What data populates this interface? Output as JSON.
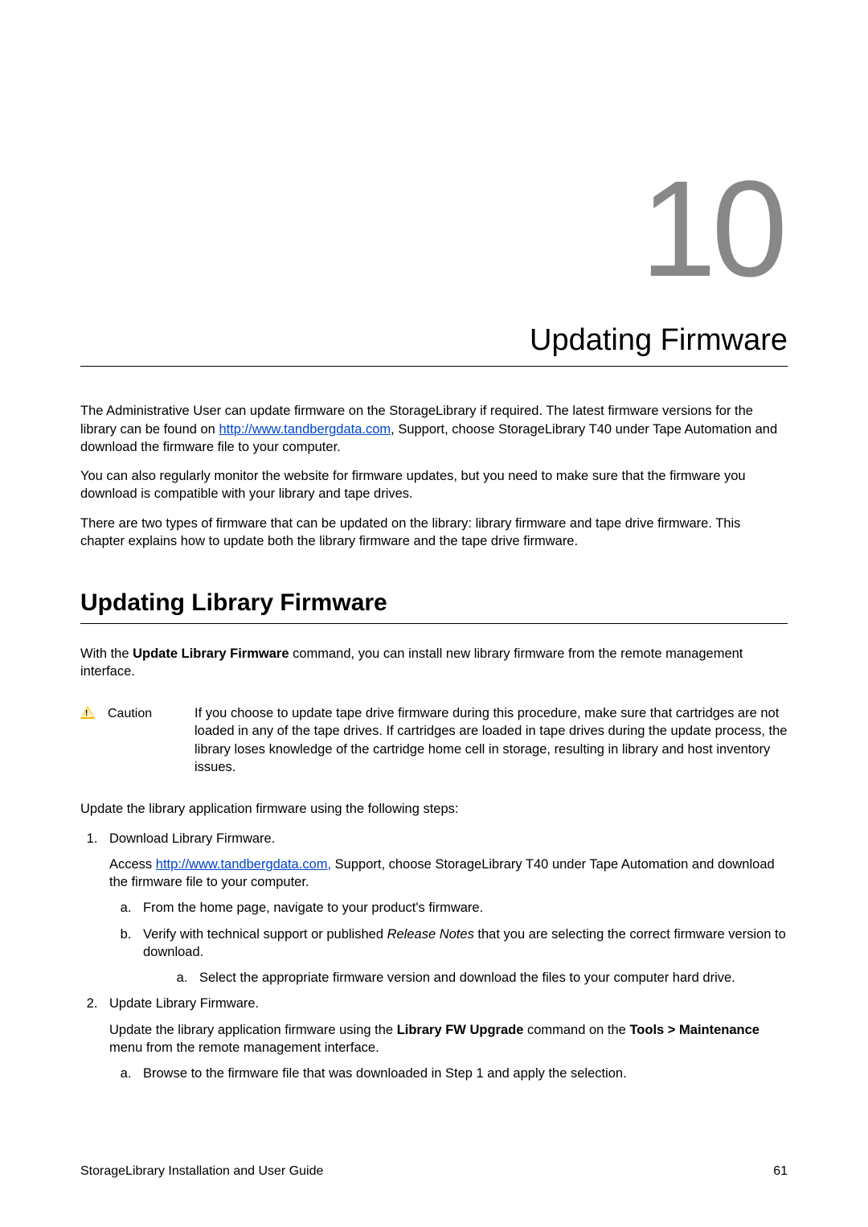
{
  "chapter": {
    "number": "10",
    "title": "Updating Firmware"
  },
  "intro": {
    "p1_prefix": "The Administrative User can update firmware on the StorageLibrary if required.  The latest firmware versions for the library can be found on ",
    "p1_link": "http://www.tandbergdata.com",
    "p1_suffix": ", Support, choose StorageLibrary T40 under Tape Automation and download the firmware file to your computer.",
    "p2": "You can also regularly monitor the website for firmware updates, but you need to make sure that the firmware you download is compatible with your library and tape drives.",
    "p3": "There are two types of firmware that can be updated on the library: library firmware and tape drive firmware. This chapter explains how to update both the library firmware and the tape drive firmware."
  },
  "section": {
    "title": "Updating Library Firmware",
    "p1_prefix": "With the ",
    "p1_bold": "Update Library Firmware",
    "p1_suffix": " command, you can install new library firmware from the remote management interface."
  },
  "caution": {
    "label": "Caution",
    "text": "If you choose to update tape drive firmware during this procedure, make sure that cartridges are not loaded in any of the tape drives. If cartridges are loaded in tape drives during the update process, the library loses knowledge of the cartridge home cell in storage, resulting in library and host inventory issues."
  },
  "steps_intro": "Update the library application firmware using the following steps:",
  "steps": {
    "s1_title": "Download Library Firmware.",
    "s1_access_prefix": "Access ",
    "s1_access_link": "http://www.tandbergdata.com,",
    "s1_access_suffix": " Support, choose StorageLibrary T40 under Tape Automation and download the firmware file to your computer.",
    "s1_a": "From the home page, navigate to your product's firmware.",
    "s1_b_prefix": "Verify with technical support or published ",
    "s1_b_italic": "Release Notes",
    "s1_b_suffix": " that you are selecting the correct firmware version to download.",
    "s1_b_inner": "Select the appropriate firmware version and download the files to your computer hard drive.",
    "s2_title": "Update Library Firmware.",
    "s2_p_prefix": "Update the library application firmware using the ",
    "s2_p_bold1": "Library FW Upgrade",
    "s2_p_mid": " command on the ",
    "s2_p_bold2": "Tools > Maintenance",
    "s2_p_suffix": " menu from the remote management interface.",
    "s2_a": "Browse to the firmware file that was downloaded in Step 1 and apply the selection."
  },
  "footer": {
    "left": "StorageLibrary Installation and User Guide",
    "right": "61"
  }
}
